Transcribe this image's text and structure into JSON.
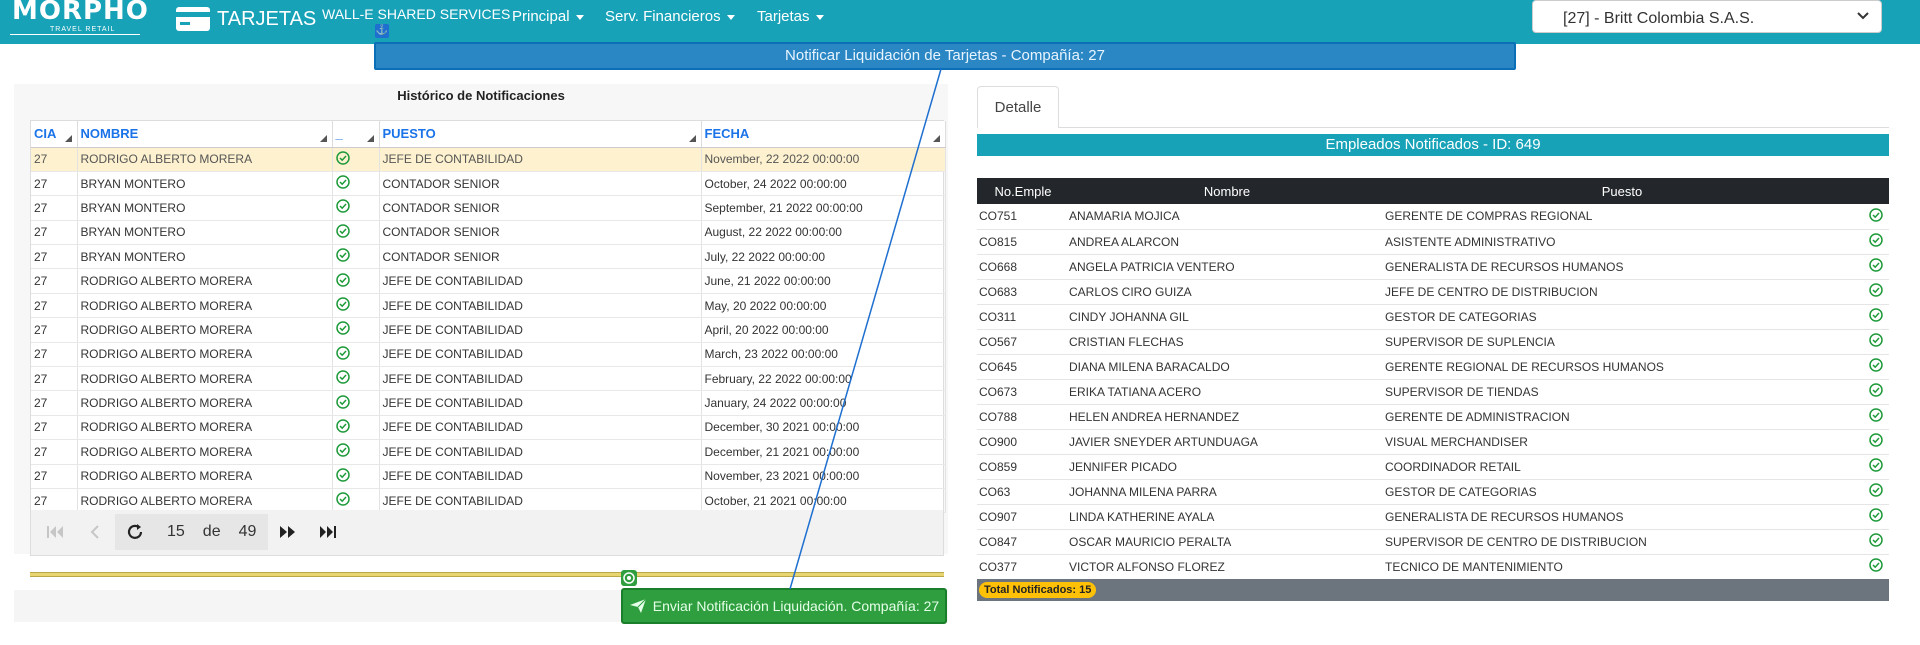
{
  "topbar": {
    "logo": "MORPHO",
    "logo_sub": "TRAVEL RETAIL",
    "brand_label": "TARJETAS",
    "org_label": "WALL-E SHARED SERVICES",
    "nav": [
      "Principal",
      "Serv. Financieros",
      "Tarjetas"
    ],
    "company_selected": "[27] - Britt Colombia S.A.S."
  },
  "notify_bar": {
    "text": "Notificar Liquidación de Tarjetas - Compañía: 27",
    "badge_icon": "anchor-icon"
  },
  "history": {
    "title": "Histórico de Notificaciones",
    "columns": [
      "CIA",
      "NOMBRE",
      "_",
      "PUESTO",
      "FECHA"
    ],
    "rows": [
      [
        "27",
        "RODRIGO ALBERTO MORERA",
        "JEFE DE CONTABILIDAD",
        "November, 22 2022 00:00:00"
      ],
      [
        "27",
        "BRYAN MONTERO",
        "CONTADOR SENIOR",
        "October, 24 2022 00:00:00"
      ],
      [
        "27",
        "BRYAN MONTERO",
        "CONTADOR SENIOR",
        "September, 21 2022 00:00:00"
      ],
      [
        "27",
        "BRYAN MONTERO",
        "CONTADOR SENIOR",
        "August, 22 2022 00:00:00"
      ],
      [
        "27",
        "BRYAN MONTERO",
        "CONTADOR SENIOR",
        "July, 22 2022 00:00:00"
      ],
      [
        "27",
        "RODRIGO ALBERTO MORERA",
        "JEFE DE CONTABILIDAD",
        "June, 21 2022 00:00:00"
      ],
      [
        "27",
        "RODRIGO ALBERTO MORERA",
        "JEFE DE CONTABILIDAD",
        "May, 20 2022 00:00:00"
      ],
      [
        "27",
        "RODRIGO ALBERTO MORERA",
        "JEFE DE CONTABILIDAD",
        "April, 20 2022 00:00:00"
      ],
      [
        "27",
        "RODRIGO ALBERTO MORERA",
        "JEFE DE CONTABILIDAD",
        "March, 23 2022 00:00:00"
      ],
      [
        "27",
        "RODRIGO ALBERTO MORERA",
        "JEFE DE CONTABILIDAD",
        "February, 22 2022 00:00:00"
      ],
      [
        "27",
        "RODRIGO ALBERTO MORERA",
        "JEFE DE CONTABILIDAD",
        "January, 24 2022 00:00:00"
      ],
      [
        "27",
        "RODRIGO ALBERTO MORERA",
        "JEFE DE CONTABILIDAD",
        "December, 30 2021 00:00:00"
      ],
      [
        "27",
        "RODRIGO ALBERTO MORERA",
        "JEFE DE CONTABILIDAD",
        "December, 21 2021 00:00:00"
      ],
      [
        "27",
        "RODRIGO ALBERTO MORERA",
        "JEFE DE CONTABILIDAD",
        "November, 23 2021 00:00:00"
      ],
      [
        "27",
        "RODRIGO ALBERTO MORERA",
        "JEFE DE CONTABILIDAD",
        "October, 21 2021 00:00:00"
      ]
    ],
    "selected_row": 0,
    "pager": {
      "page": "15",
      "of_label": "de",
      "total": "49"
    }
  },
  "send_button": {
    "label": "Enviar Notificación Liquidación. Compañía: 27",
    "icon": "paper-plane-icon"
  },
  "detail": {
    "tab_label": "Detalle",
    "header": "Empleados Notificados - ID: 649",
    "columns": [
      "No.Emple",
      "Nombre",
      "Puesto"
    ],
    "rows": [
      [
        "CO751",
        "ANAMARIA MOJICA",
        "GERENTE DE COMPRAS REGIONAL"
      ],
      [
        "CO815",
        "ANDREA ALARCON",
        "ASISTENTE ADMINISTRATIVO"
      ],
      [
        "CO668",
        "ANGELA PATRICIA VENTERO",
        "GENERALISTA DE RECURSOS HUMANOS"
      ],
      [
        "CO683",
        "CARLOS CIRO GUIZA",
        "JEFE DE CENTRO DE DISTRIBUCION"
      ],
      [
        "CO311",
        "CINDY JOHANNA GIL",
        "GESTOR DE CATEGORIAS"
      ],
      [
        "CO567",
        "CRISTIAN FLECHAS",
        "SUPERVISOR DE SUPLENCIA"
      ],
      [
        "CO645",
        "DIANA MILENA BARACALDO",
        "GERENTE REGIONAL DE RECURSOS HUMANOS"
      ],
      [
        "CO673",
        "ERIKA TATIANA ACERO",
        "SUPERVISOR DE TIENDAS"
      ],
      [
        "CO788",
        "HELEN ANDREA HERNANDEZ",
        "GERENTE DE ADMINISTRACION"
      ],
      [
        "CO900",
        "JAVIER SNEYDER ARTUNDUAGA",
        "VISUAL MERCHANDISER"
      ],
      [
        "CO859",
        "JENNIFER PICADO",
        "COORDINADOR RETAIL"
      ],
      [
        "CO63",
        "JOHANNA MILENA PARRA",
        "GESTOR DE CATEGORIAS"
      ],
      [
        "CO907",
        "LINDA KATHERINE AYALA",
        "GENERALISTA DE RECURSOS HUMANOS"
      ],
      [
        "CO847",
        "OSCAR MAURICIO PERALTA",
        "SUPERVISOR DE CENTRO DE DISTRIBUCION"
      ],
      [
        "CO377",
        "VICTOR ALFONSO FLOREZ",
        "TECNICO DE MANTENIMIENTO"
      ]
    ],
    "total_label": "Total Notificados: 15"
  },
  "colors": {
    "primary": "#17a2b8",
    "accent_blue": "#2a87c4",
    "send_green": "#2e9e3e",
    "selected_row": "#fdf1cf",
    "check_green": "#1e9a3a",
    "link_blue": "#1a73e8"
  }
}
